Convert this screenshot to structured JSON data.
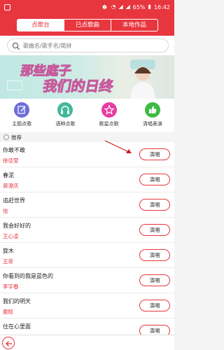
{
  "status_bar": {
    "battery": "65%",
    "time": "16:42",
    "icons": [
      "notification-icon",
      "alarm-icon",
      "wifi-icon",
      "signal-icon",
      "battery-icon"
    ]
  },
  "tabs": [
    {
      "label": "点歌台",
      "active": true
    },
    {
      "label": "已点歌曲",
      "active": false
    },
    {
      "label": "本地作品",
      "active": false
    }
  ],
  "search": {
    "placeholder": "歌曲名/歌手名/简拼"
  },
  "banner": {
    "text": "那些庭子我们的日终"
  },
  "quick_menu": [
    {
      "label": "主题点歌",
      "icon": "pencil-icon",
      "color": "#6c6fd7"
    },
    {
      "label": "语种点歌",
      "icon": "headphones-icon",
      "color": "#45b89b"
    },
    {
      "label": "歌星点歌",
      "icon": "star-icon",
      "color": "#e63da2"
    },
    {
      "label": "清唱表演",
      "icon": "thumbs-up-icon",
      "color": "#3dbb43"
    }
  ],
  "list_header": {
    "label": "推荐"
  },
  "songs": [
    {
      "name": "你敢不敢",
      "singer": "徐佳莹",
      "action": "演唱"
    },
    {
      "name": "春泥",
      "singer": "庾澄庆",
      "action": "演唱"
    },
    {
      "name": "追赶世界",
      "singer": "信",
      "action": "演唱"
    },
    {
      "name": "我会好好的",
      "singer": "王心凌",
      "action": "演唱"
    },
    {
      "name": "旋木",
      "singer": "王菲",
      "action": "演唱"
    },
    {
      "name": "你看到的我是蓝色的",
      "singer": "李宇春",
      "action": "演唱"
    },
    {
      "name": "我们的明天",
      "singer": "鹿晗",
      "action": "演唱"
    },
    {
      "name": "住在心里面",
      "singer": "",
      "action": "演唱"
    }
  ],
  "colors": {
    "accent": "#e8363f",
    "background": "#f4f4f4"
  }
}
